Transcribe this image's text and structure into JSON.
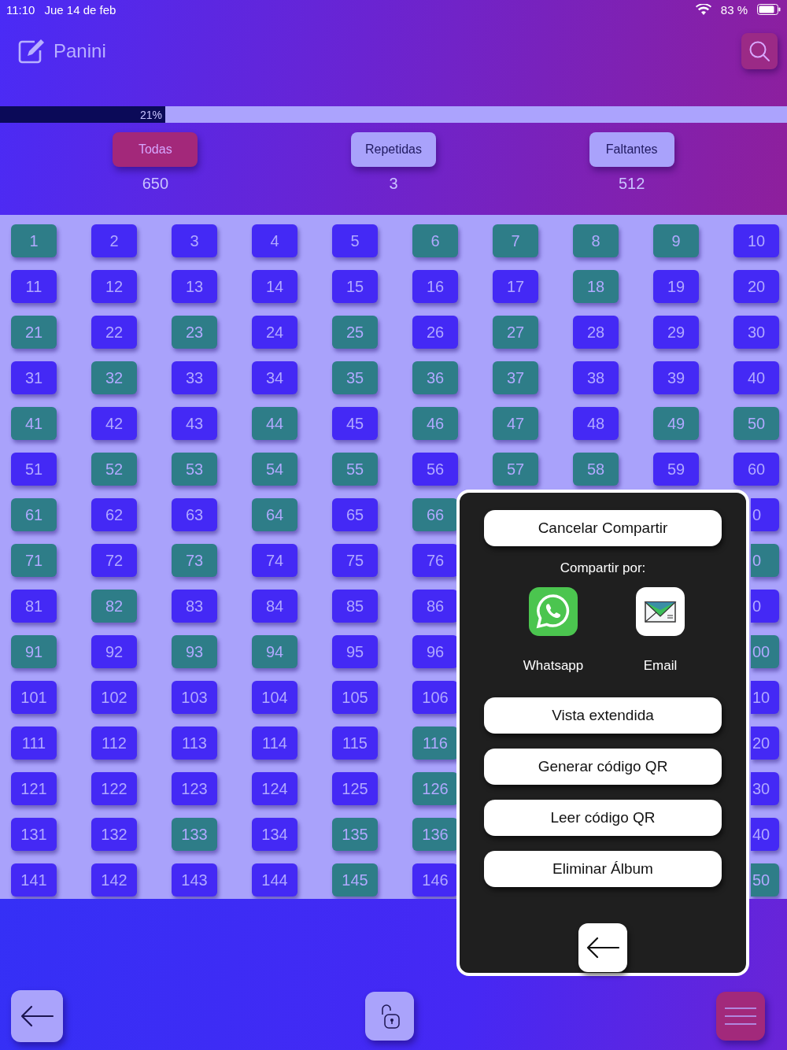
{
  "status_bar": {
    "time": "11:10",
    "date": "Jue 14 de feb",
    "battery": "83 %"
  },
  "header": {
    "title": "Panini"
  },
  "progress": {
    "label": "21%",
    "level": 0.21
  },
  "filters": [
    {
      "label": "Todas",
      "count": "650",
      "selected": true
    },
    {
      "label": "Repetidas",
      "count": "3",
      "selected": false
    },
    {
      "label": "Faltantes",
      "count": "512",
      "selected": false
    }
  ],
  "sticker_rows": [
    [
      {
        "number": "1",
        "owned": true
      },
      {
        "number": "2",
        "owned": false
      },
      {
        "number": "3",
        "owned": false
      },
      {
        "number": "4",
        "owned": false
      },
      {
        "number": "5",
        "owned": false
      },
      {
        "number": "6",
        "owned": true
      },
      {
        "number": "7",
        "owned": true
      },
      {
        "number": "8",
        "owned": true
      },
      {
        "number": "9",
        "owned": true
      },
      {
        "number": "10",
        "owned": false
      }
    ],
    [
      {
        "number": "11",
        "owned": false
      },
      {
        "number": "12",
        "owned": false
      },
      {
        "number": "13",
        "owned": false
      },
      {
        "number": "14",
        "owned": false
      },
      {
        "number": "15",
        "owned": false
      },
      {
        "number": "16",
        "owned": false
      },
      {
        "number": "17",
        "owned": false
      },
      {
        "number": "18",
        "owned": true
      },
      {
        "number": "19",
        "owned": false
      },
      {
        "number": "20",
        "owned": false
      }
    ],
    [
      {
        "number": "21",
        "owned": true
      },
      {
        "number": "22",
        "owned": false
      },
      {
        "number": "23",
        "owned": true
      },
      {
        "number": "24",
        "owned": false
      },
      {
        "number": "25",
        "owned": true
      },
      {
        "number": "26",
        "owned": false
      },
      {
        "number": "27",
        "owned": true
      },
      {
        "number": "28",
        "owned": false
      },
      {
        "number": "29",
        "owned": false
      },
      {
        "number": "30",
        "owned": false
      }
    ],
    [
      {
        "number": "31",
        "owned": false
      },
      {
        "number": "32",
        "owned": true
      },
      {
        "number": "33",
        "owned": false
      },
      {
        "number": "34",
        "owned": false
      },
      {
        "number": "35",
        "owned": true
      },
      {
        "number": "36",
        "owned": true
      },
      {
        "number": "37",
        "owned": true
      },
      {
        "number": "38",
        "owned": false
      },
      {
        "number": "39",
        "owned": false
      },
      {
        "number": "40",
        "owned": false
      }
    ],
    [
      {
        "number": "41",
        "owned": true
      },
      {
        "number": "42",
        "owned": false
      },
      {
        "number": "43",
        "owned": false
      },
      {
        "number": "44",
        "owned": true
      },
      {
        "number": "45",
        "owned": false
      },
      {
        "number": "46",
        "owned": true
      },
      {
        "number": "47",
        "owned": true
      },
      {
        "number": "48",
        "owned": false
      },
      {
        "number": "49",
        "owned": true
      },
      {
        "number": "50",
        "owned": true
      }
    ],
    [
      {
        "number": "51",
        "owned": false
      },
      {
        "number": "52",
        "owned": true
      },
      {
        "number": "53",
        "owned": true
      },
      {
        "number": "54",
        "owned": true
      },
      {
        "number": "55",
        "owned": true
      },
      {
        "number": "56",
        "owned": false
      },
      {
        "number": "57",
        "owned": true
      },
      {
        "number": "58",
        "owned": true
      },
      {
        "number": "59",
        "owned": false
      },
      {
        "number": "60",
        "owned": false
      }
    ],
    [
      {
        "number": "61",
        "owned": true
      },
      {
        "number": "62",
        "owned": false
      },
      {
        "number": "63",
        "owned": false
      },
      {
        "number": "64",
        "owned": true
      },
      {
        "number": "65",
        "owned": false
      },
      {
        "number": "66",
        "owned": true
      },
      {
        "number": "0",
        "owned": false,
        "kind": "partial"
      }
    ],
    [
      {
        "number": "71",
        "owned": true
      },
      {
        "number": "72",
        "owned": false
      },
      {
        "number": "73",
        "owned": true
      },
      {
        "number": "74",
        "owned": false
      },
      {
        "number": "75",
        "owned": false
      },
      {
        "number": "76",
        "owned": false
      },
      {
        "number": "0",
        "owned": true,
        "kind": "partial"
      }
    ],
    [
      {
        "number": "81",
        "owned": false
      },
      {
        "number": "82",
        "owned": true
      },
      {
        "number": "83",
        "owned": false
      },
      {
        "number": "84",
        "owned": false
      },
      {
        "number": "85",
        "owned": false
      },
      {
        "number": "86",
        "owned": false
      },
      {
        "number": "0",
        "owned": false,
        "kind": "partial"
      }
    ],
    [
      {
        "number": "91",
        "owned": true
      },
      {
        "number": "92",
        "owned": false
      },
      {
        "number": "93",
        "owned": true
      },
      {
        "number": "94",
        "owned": true
      },
      {
        "number": "95",
        "owned": false
      },
      {
        "number": "96",
        "owned": false
      },
      {
        "number": "00",
        "owned": true,
        "kind": "partial"
      }
    ],
    [
      {
        "number": "101",
        "owned": false
      },
      {
        "number": "102",
        "owned": false
      },
      {
        "number": "103",
        "owned": false
      },
      {
        "number": "104",
        "owned": false
      },
      {
        "number": "105",
        "owned": false
      },
      {
        "number": "106",
        "owned": false
      },
      {
        "number": "10",
        "owned": false,
        "kind": "partial"
      }
    ],
    [
      {
        "number": "111",
        "owned": false
      },
      {
        "number": "112",
        "owned": false
      },
      {
        "number": "113",
        "owned": false
      },
      {
        "number": "114",
        "owned": false
      },
      {
        "number": "115",
        "owned": false
      },
      {
        "number": "116",
        "owned": true
      },
      {
        "number": "20",
        "owned": false,
        "kind": "partial"
      }
    ],
    [
      {
        "number": "121",
        "owned": false
      },
      {
        "number": "122",
        "owned": false
      },
      {
        "number": "123",
        "owned": false
      },
      {
        "number": "124",
        "owned": false
      },
      {
        "number": "125",
        "owned": false
      },
      {
        "number": "126",
        "owned": true
      },
      {
        "number": "30",
        "owned": false,
        "kind": "partial"
      }
    ],
    [
      {
        "number": "131",
        "owned": false
      },
      {
        "number": "132",
        "owned": false
      },
      {
        "number": "133",
        "owned": true
      },
      {
        "number": "134",
        "owned": false
      },
      {
        "number": "135",
        "owned": true
      },
      {
        "number": "136",
        "owned": true
      },
      {
        "number": "40",
        "owned": false,
        "kind": "partial"
      }
    ],
    [
      {
        "number": "141",
        "owned": false
      },
      {
        "number": "142",
        "owned": false
      },
      {
        "number": "143",
        "owned": false
      },
      {
        "number": "144",
        "owned": false
      },
      {
        "number": "145",
        "owned": true
      },
      {
        "number": "146",
        "owned": false
      },
      {
        "number": "50",
        "owned": true,
        "kind": "partial"
      }
    ]
  ],
  "share_dialog": {
    "cancel": "Cancelar Compartir",
    "share_label": "Compartir por:",
    "share_options": [
      {
        "kind": "whatsapp",
        "label": "Whatsapp"
      },
      {
        "kind": "email",
        "label": "Email"
      }
    ],
    "actions": [
      "Vista extendida",
      "Generar código QR",
      "Leer código QR",
      "Eliminar Álbum"
    ]
  }
}
